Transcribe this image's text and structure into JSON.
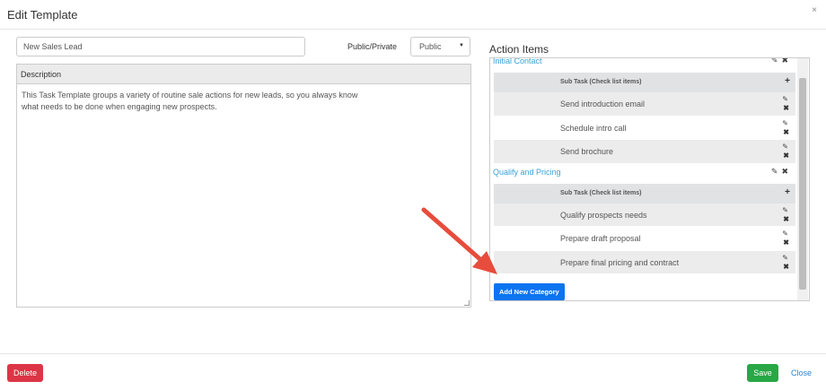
{
  "modal": {
    "title": "Edit Template",
    "close_glyph": "×"
  },
  "form": {
    "name_value": "New Sales Lead",
    "visibility_label": "Public/Private",
    "visibility_value": "Public",
    "description_header": "Description",
    "description_line1": "This Task Template groups a variety of routine sale actions for new leads, so you always know",
    "description_line2": "what needs to be done when engaging new prospects."
  },
  "action_items": {
    "title": "Action Items",
    "subtask_header": "Sub Task (Check list items)",
    "categories": [
      {
        "name": "Initial Contact",
        "tasks": [
          "Send introduction email",
          "Schedule intro call",
          "Send brochure"
        ]
      },
      {
        "name": "Qualify and Pricing",
        "tasks": [
          "Qualify prospects needs",
          "Prepare draft proposal",
          "Prepare final pricing and contract"
        ]
      }
    ],
    "add_category_label": "Add New Category"
  },
  "footer": {
    "delete_label": "Delete",
    "save_label": "Save",
    "close_label": "Close"
  },
  "colors": {
    "link": "#3aa2d8",
    "primary": "#0d74f0",
    "danger": "#dc3545",
    "success": "#28a745",
    "annotation_arrow": "#e74c3c"
  },
  "icons": {
    "edit": "edit-icon",
    "delete": "delete-x-icon",
    "add": "plus-icon",
    "caret": "caret-down-icon"
  }
}
